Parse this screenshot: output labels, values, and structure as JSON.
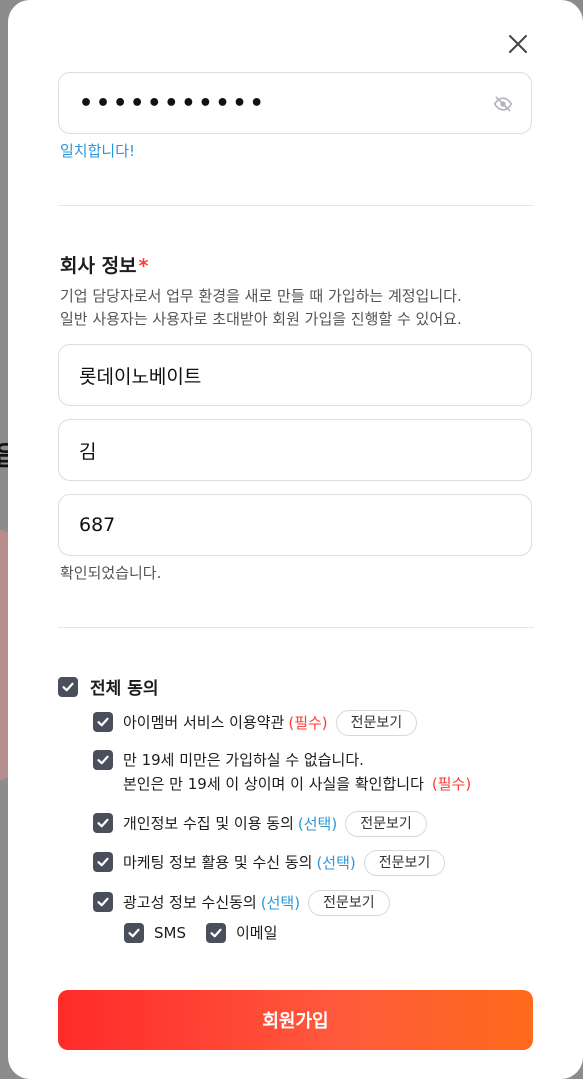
{
  "password": {
    "masked_value": "•••••••••••",
    "match_message": "일치합니다!"
  },
  "company_section": {
    "title": "회사 정보",
    "required_mark": "*",
    "description_line1": "기업 담당자로서 업무 환경을 새로 만들 때 가입하는 계정입니다.",
    "description_line2": "일반 사용자는 사용자로 초대받아 회원 가입을 진행할 수 있어요.",
    "company_name": "롯데이노베이트",
    "name": "김",
    "code": "687",
    "code_status": "확인되었습니다."
  },
  "agreements": {
    "all_label": "전체 동의",
    "view_label": "전문보기",
    "items": [
      {
        "label": "아이멤버 서비스 이용약관",
        "tag": "(필수)"
      },
      {
        "label_line1": "만 19세 미만은 가입하실 수 없습니다.",
        "label_line2": "본인은 만 19세 이 상이며 이 사실을 확인합니다",
        "tag": "(필수)"
      },
      {
        "label": "개인정보 수집 및 이용 동의",
        "tag": "(선택)"
      },
      {
        "label": "마케팅 정보 활용 및 수신 동의",
        "tag": "(선택)"
      },
      {
        "label": "광고성 정보 수신동의",
        "tag": "(선택)"
      }
    ],
    "channels": [
      "SMS",
      "이메일"
    ]
  },
  "submit_label": "회원가입",
  "colors": {
    "accent_blue": "#2a98d8",
    "required_red": "#ff3b30",
    "checkbox": "#4a4f5c",
    "button_gradient_start": "#ff2a2a",
    "button_gradient_end": "#ff6a1c"
  },
  "icons": {
    "close": "close-icon",
    "password_visibility": "eye-off-icon",
    "check": "check-icon"
  }
}
